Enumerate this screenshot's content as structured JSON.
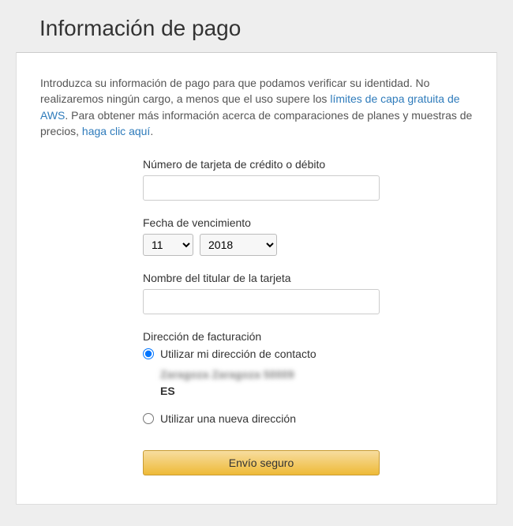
{
  "header": {
    "title": "Información de pago"
  },
  "intro": {
    "part1": "Introduzca su información de pago para que podamos verificar su identidad. No realizaremos ningún cargo, a menos que el uso supere los ",
    "link1": "límites de capa gratuita de AWS",
    "part2": ". Para obtener más información acerca de comparaciones de planes y muestras de precios, ",
    "link2": "haga clic aquí",
    "part3": "."
  },
  "form": {
    "card_number": {
      "label": "Número de tarjeta de crédito o débito",
      "value": ""
    },
    "expiry": {
      "label": "Fecha de vencimiento",
      "month_selected": "11",
      "year_selected": "2018"
    },
    "cardholder": {
      "label": "Nombre del titular de la tarjeta",
      "value": ""
    },
    "billing": {
      "section_label": "Dirección de facturación",
      "option_contact": "Utilizar mi dirección de contacto",
      "option_new": "Utilizar una nueva dirección",
      "selected": "contact",
      "address": {
        "line1": "                         ",
        "line2": "Zaragoza Zaragoza 50009",
        "line3": "ES"
      }
    },
    "submit_label": "Envío seguro"
  }
}
